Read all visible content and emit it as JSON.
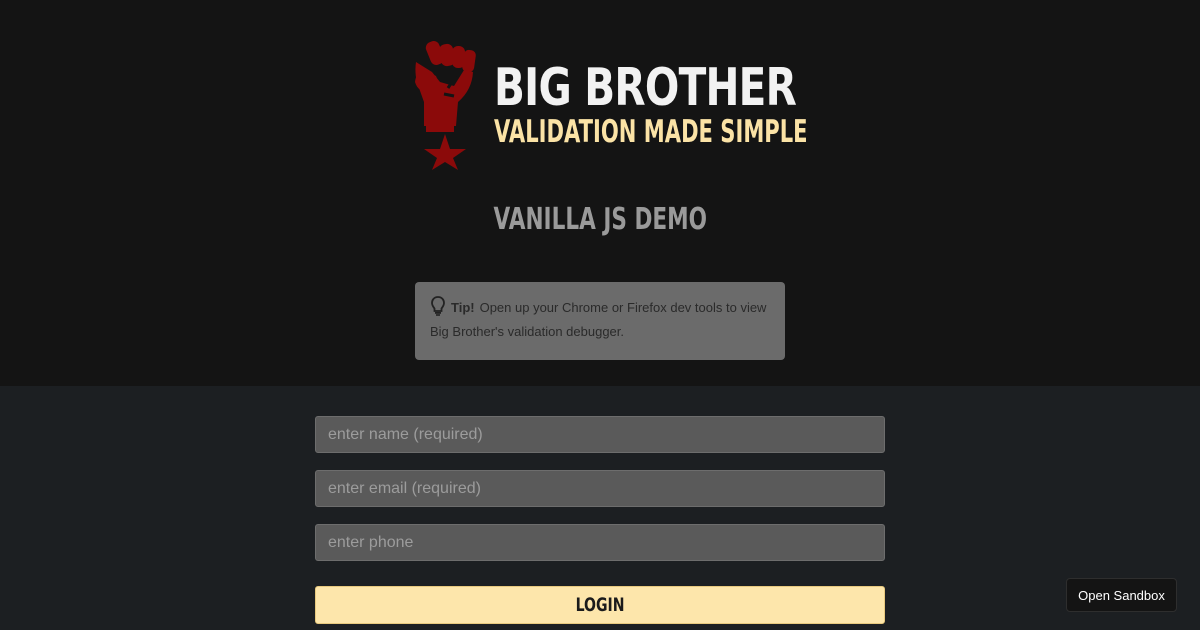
{
  "brand": {
    "title": "BIG BROTHER",
    "subtitle": "VALIDATION MADE SIMPLE",
    "logo_icon": "raised-fist-star-icon",
    "logo_color": "#8b0a0a"
  },
  "demo": {
    "title": "VANILLA JS DEMO"
  },
  "tip": {
    "icon": "lightbulb-icon",
    "label": "Tip!",
    "text": "Open up your Chrome or Firefox dev tools to view Big Brother's validation debugger."
  },
  "form": {
    "name_placeholder": "enter name (required)",
    "email_placeholder": "enter email (required)",
    "phone_placeholder": "enter phone",
    "name_value": "",
    "email_value": "",
    "phone_value": "",
    "login_label": "LOGIN"
  },
  "sandbox": {
    "label": "Open Sandbox"
  },
  "colors": {
    "header_bg": "#141414",
    "body_bg": "#1c1f22",
    "accent": "#fde6ab",
    "tip_bg": "#6b6b6b"
  }
}
